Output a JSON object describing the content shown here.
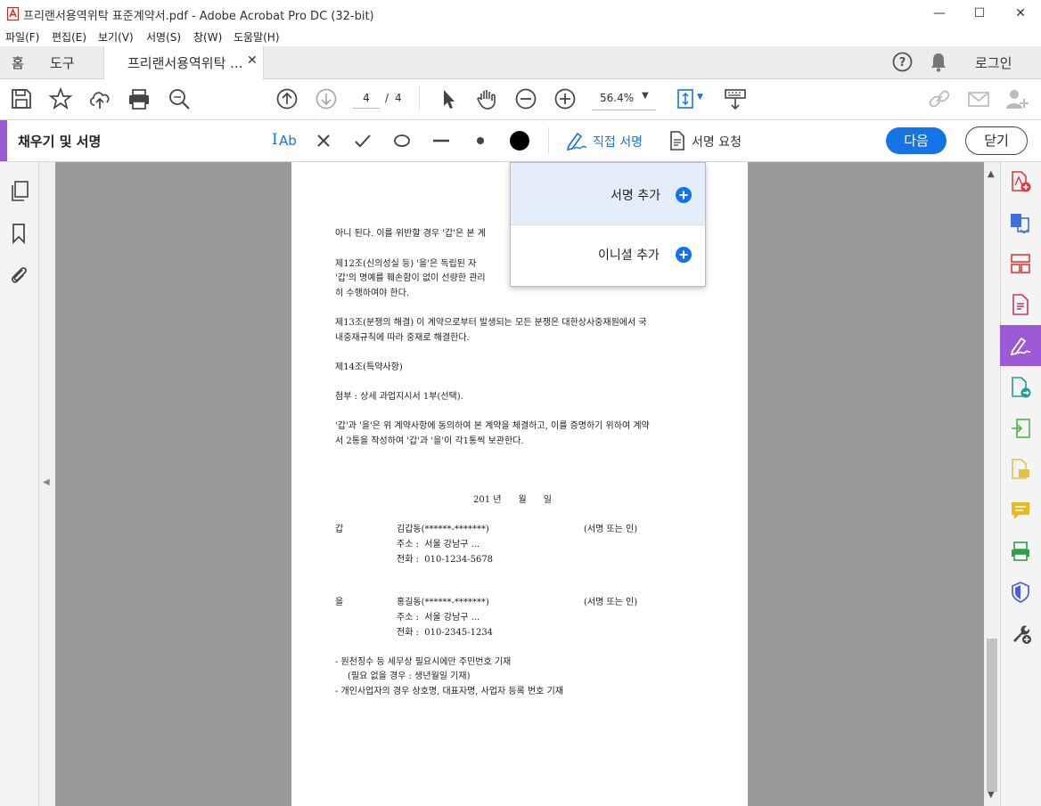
{
  "window": {
    "title": "프리랜서용역위탁 표준계약서.pdf - Adobe Acrobat Pro DC (32-bit)",
    "minimize": "—",
    "maximize": "☐",
    "close": "✕"
  },
  "menu": [
    "파일(F)",
    "편집(E)",
    "보기(V)",
    "서명(S)",
    "창(W)",
    "도움말(H)"
  ],
  "tabs": {
    "home": "홈",
    "tools": "도구",
    "document": "프리랜서용역위탁 ...",
    "login": "로그인"
  },
  "toolbar": {
    "page_current": "4",
    "page_sep": "/",
    "page_total": "4",
    "zoom": "56.4%"
  },
  "fill_sign": {
    "title": "채우기 및 서명",
    "text_tool": "Ab",
    "self_sign": "직접 서명",
    "request_sign": "서명 요청",
    "next": "다음",
    "close": "닫기"
  },
  "popup": {
    "add_signature": "서명 추가",
    "add_initials": "이니셜 추가"
  },
  "document": {
    "lines": [
      "아니 된다. 이를 위반할 경우 '갑'은 본 계",
      "제12조(신의성실 등) '을'은 독립된 자",
      "'갑'의 명예를 훼손함이 없이 선량한 관리",
      "히 수행하여야 한다.",
      "제13조(분쟁의 해결) 이 계약으로부터 발생되는 모든 분쟁은 대한상사중재원에서 국",
      "내중재규칙에 따라 중재로 해결한다.",
      "제14조(특약사항)",
      "첨부 : 상세 과업지시서 1부(선택).",
      "'갑'과 '을'은 위 계약사항에 동의하여 본 계약을 체결하고, 이를 증명하기 위하여 계약",
      "서 2통을 작성하여 '갑'과 '을'이 각1통씩 보관한다."
    ],
    "date_line": "201 년      월      일",
    "party_a": {
      "label": "갑",
      "name": "김갑동(******-*******)",
      "sign": "(서명 또는 인)",
      "address": "주소 :  서울 강남구 ...",
      "phone": "전화 :  010-1234-5678"
    },
    "party_b": {
      "label": "을",
      "name": "홍길동(******-*******)",
      "sign": "(서명 또는 인)",
      "address": "주소 :  서울 강남구 ...",
      "phone": "전화 :  010-2345-1234"
    },
    "notes": [
      "- 원천징수 등 세무상 필요시에만 주민번호 기재",
      "(필요 없을 경우 : 생년월일 기재)",
      "- 개인사업자의 경우 상호명, 대표자명, 사업자 등록 번호 기재"
    ]
  },
  "colors": {
    "accent_blue": "#1473e6",
    "fill_sign_purple": "#9b59d6"
  }
}
